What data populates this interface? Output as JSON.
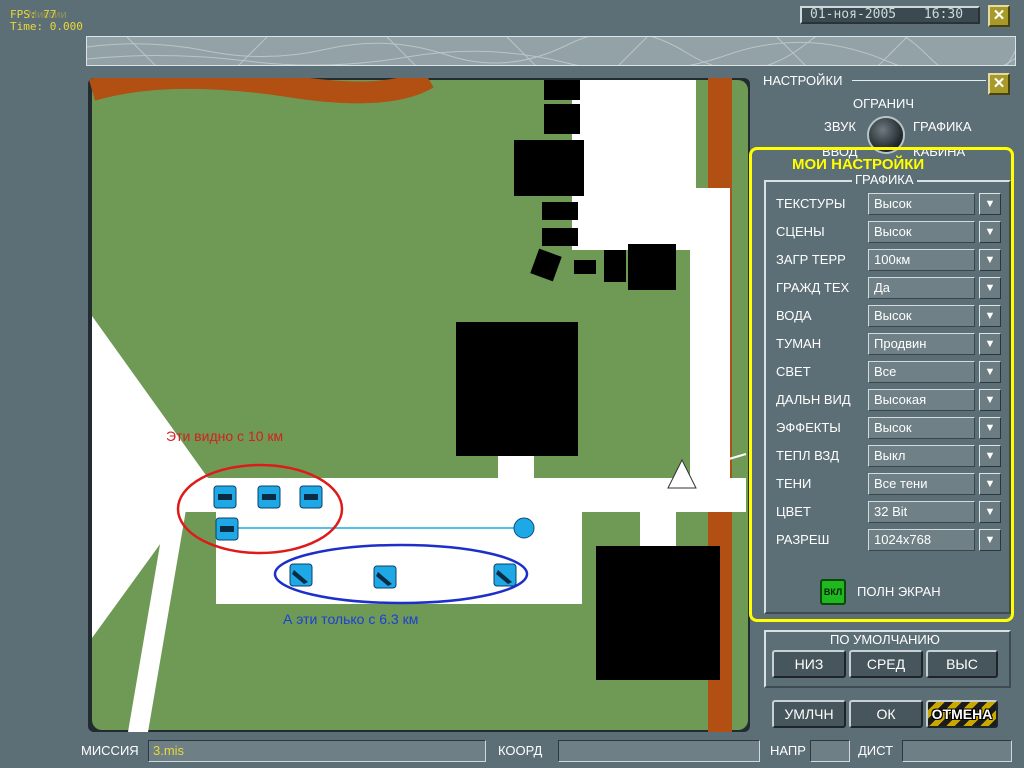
{
  "overlay": {
    "fps_label": "FPS: 77",
    "time_label": "Time: 0.000",
    "ghost_text": "Миссии"
  },
  "header": {
    "date": "01-ноя-2005",
    "time": "16:30"
  },
  "map": {
    "annotation_red": "Эти видно с 10 км",
    "annotation_blue": "А эти только с 6.3 км",
    "colors": {
      "grass": "#6f9a55",
      "road": "#b24f12",
      "runway": "#ffffff",
      "building": "#000000",
      "unit": "#1ea8e6",
      "red_ellipse": "#dd1b1b",
      "blue_ellipse": "#1c2fc8"
    }
  },
  "settings": {
    "title": "НАСТРОЙКИ",
    "knob": {
      "top": "ОГРАНИЧ",
      "left": "ЗВУК",
      "right": "ГРАФИКА",
      "bottom_left": "ВВОД",
      "bottom_right": "КАБИНА"
    },
    "my_settings": "МОИ НАСТРОЙКИ",
    "group_title": "ГРАФИКА",
    "rows": [
      {
        "label": "ТЕКСТУРЫ",
        "value": "Высок"
      },
      {
        "label": "СЦЕНЫ",
        "value": "Высок"
      },
      {
        "label": "ЗАГР ТЕРР",
        "value": "100км"
      },
      {
        "label": "ГРАЖД ТЕХ",
        "value": "Да"
      },
      {
        "label": "ВОДА",
        "value": "Высок"
      },
      {
        "label": "ТУМАН",
        "value": "Продвин"
      },
      {
        "label": "СВЕТ",
        "value": "Все"
      },
      {
        "label": "ДАЛЬН ВИД",
        "value": "Высокая"
      },
      {
        "label": "ЭФФЕКТЫ",
        "value": "Высок"
      },
      {
        "label": "ТЕПЛ ВЗД",
        "value": "Выкл"
      },
      {
        "label": "ТЕНИ",
        "value": "Все тени"
      },
      {
        "label": "ЦВЕТ",
        "value": "32 Bit"
      },
      {
        "label": "РАЗРЕШ",
        "value": "1024x768"
      }
    ],
    "fullscreen_toggle": "ВКЛ",
    "fullscreen_label": "ПОЛН ЭКРАН",
    "defaults_title": "ПО УМОЛЧАНИЮ",
    "defaults": {
      "low": "НИЗ",
      "mid": "СРЕД",
      "high": "ВЫС"
    },
    "buttons": {
      "default": "УМЛЧН",
      "ok": "ОК",
      "cancel": "ОТМЕНА"
    }
  },
  "bottom": {
    "mission_label": "МИССИЯ",
    "mission_value": "3.mis",
    "coord_label": "КООРД",
    "coord_value": "",
    "heading_label": "НАПР",
    "heading_value": "",
    "dist_label": "ДИСТ",
    "dist_value": ""
  }
}
